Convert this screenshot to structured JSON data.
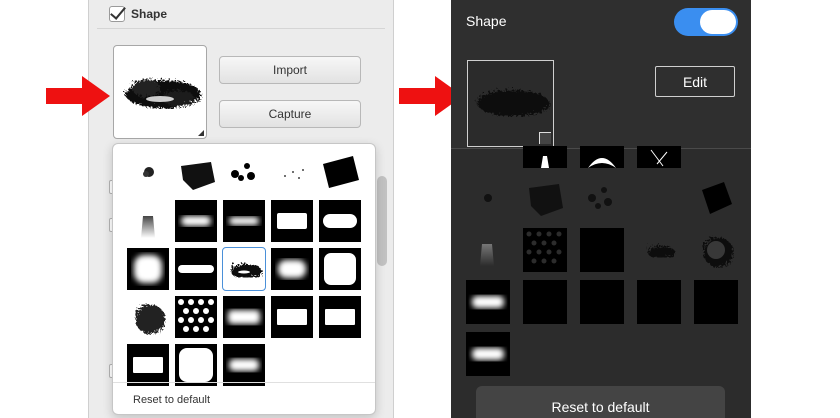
{
  "left_panel": {
    "shape_label": "Shape",
    "shape_checked": true,
    "import_label": "Import",
    "capture_label": "Capture",
    "reset_label": "Reset to default"
  },
  "right_panel": {
    "shape_label": "Shape",
    "toggle_on": true,
    "edit_label": "Edit",
    "reset_label": "Reset to default"
  },
  "colors": {
    "arrow": "#ee1111",
    "toggle_accent": "#3a8ef0",
    "selection": "#4a90d9"
  }
}
